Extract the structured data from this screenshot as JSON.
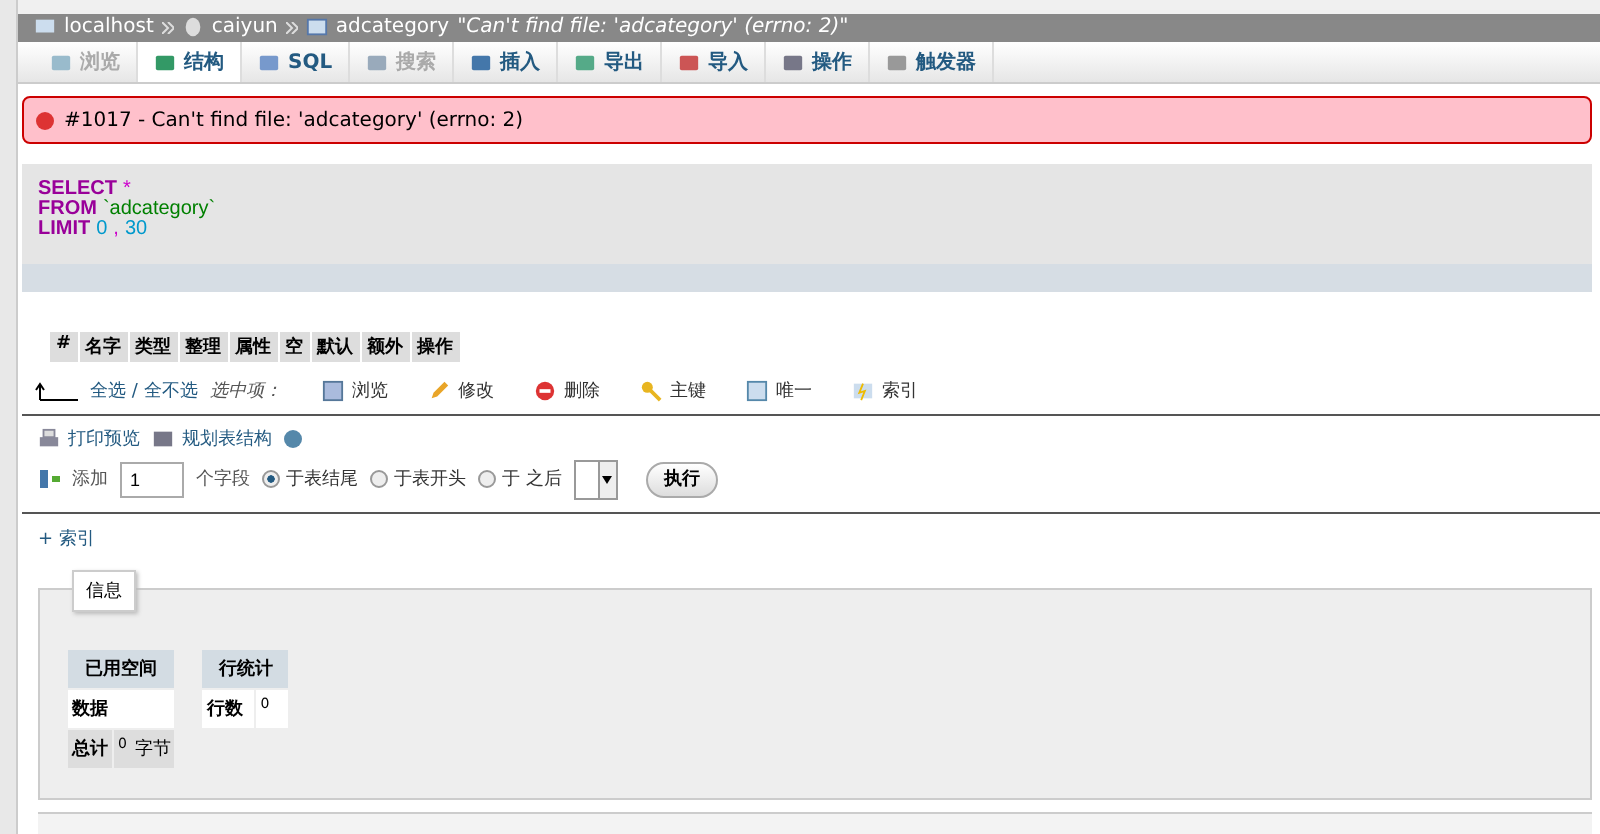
{
  "breadcrumb": [
    {
      "label": "localhost"
    },
    {
      "label": "caiyun"
    },
    {
      "label": "adcategory"
    }
  ],
  "breadcrumb_note": "\"Can't find file: 'adcategory' (errno: 2)\"",
  "tabs": [
    {
      "label": "浏览",
      "selected": false,
      "disabled": true
    },
    {
      "label": "结构",
      "selected": true,
      "disabled": false
    },
    {
      "label": "SQL",
      "selected": false,
      "disabled": false
    },
    {
      "label": "搜索",
      "selected": false,
      "disabled": true
    },
    {
      "label": "插入",
      "selected": false,
      "disabled": false
    },
    {
      "label": "导出",
      "selected": false,
      "disabled": false
    },
    {
      "label": "导入",
      "selected": false,
      "disabled": false
    },
    {
      "label": "操作",
      "selected": false,
      "disabled": false
    },
    {
      "label": "触发器",
      "selected": false,
      "disabled": false
    }
  ],
  "error": "#1017 - Can't find file: 'adcategory' (errno: 2)",
  "sql": [
    [
      {
        "t": "SELECT",
        "kind": "keyword"
      },
      {
        "t": "*",
        "kind": "operator"
      }
    ],
    [
      {
        "t": "FROM",
        "kind": "keyword"
      },
      {
        "t": "`adcategory`",
        "kind": "identifier"
      }
    ],
    [
      {
        "t": "LIMIT",
        "kind": "keyword"
      },
      {
        "t": "0",
        "kind": "number"
      },
      {
        "t": ",",
        "kind": "operator"
      },
      {
        "t": "30",
        "kind": "number"
      }
    ]
  ],
  "columns": [
    "#",
    "名字",
    "类型",
    "整理",
    "属性",
    "空",
    "默认",
    "额外",
    "操作"
  ],
  "bulk": {
    "select_all": "全选 / 全不选",
    "with_selected": "选中项：",
    "actions": [
      "浏览",
      "修改",
      "删除",
      "主键",
      "唯一",
      "索引"
    ]
  },
  "links": [
    "打印预览",
    "规划表结构"
  ],
  "add": {
    "label": "添加",
    "value": "1",
    "unit": "个字段",
    "options": [
      {
        "label": "于表结尾",
        "selected": true
      },
      {
        "label": "于表开头",
        "selected": false
      },
      {
        "label": "于 之后",
        "selected": false
      }
    ],
    "button": "执行"
  },
  "index_link": "+ 索引",
  "info": {
    "legend": "信息",
    "space": {
      "heading": "已用空间",
      "rows": [
        {
          "label": "数据"
        }
      ],
      "total": {
        "label": "总计",
        "value": "0",
        "unit": "字节"
      }
    },
    "rows": {
      "heading": "行统计",
      "label": "行数",
      "value": "0"
    }
  }
}
